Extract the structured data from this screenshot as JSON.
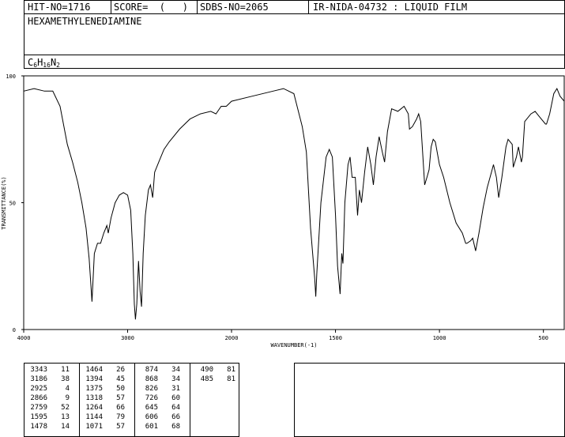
{
  "header": {
    "hit_no": "HIT-NO=1716",
    "score": "SCORE=  (   )",
    "sdbs_no": "SDBS-NO=2065",
    "ir_code": "IR-NIDA-04732 : LIQUID FILM",
    "compound_name": "HEXAMETHYLENEDIAMINE",
    "formula": {
      "C": "C",
      "c_count": "6",
      "H": "H",
      "h_count": "16",
      "N": "N",
      "n_count": "2"
    }
  },
  "chart_data": {
    "type": "line",
    "xlabel": "WAVENUMBER(-1)",
    "ylabel": "TRANSMITTANCE(%)",
    "xlim": [
      4000,
      400
    ],
    "ylim": [
      0,
      100
    ],
    "x_ticks": [
      "4000",
      "3000",
      "2000",
      "1500",
      "1000",
      "500"
    ],
    "x_tick_values": [
      4000,
      3000,
      2000,
      1500,
      1000,
      500
    ],
    "y_ticks": [
      "0",
      "50",
      "100"
    ],
    "y_tick_values": [
      0,
      50,
      100
    ],
    "series": [
      {
        "points": [
          [
            4000,
            94
          ],
          [
            3900,
            95
          ],
          [
            3800,
            94
          ],
          [
            3720,
            94
          ],
          [
            3650,
            88
          ],
          [
            3580,
            73
          ],
          [
            3530,
            66
          ],
          [
            3480,
            58
          ],
          [
            3440,
            50
          ],
          [
            3400,
            40
          ],
          [
            3370,
            28
          ],
          [
            3343,
            11
          ],
          [
            3320,
            30
          ],
          [
            3290,
            34
          ],
          [
            3260,
            34
          ],
          [
            3230,
            38
          ],
          [
            3200,
            41
          ],
          [
            3186,
            38
          ],
          [
            3160,
            44
          ],
          [
            3120,
            50
          ],
          [
            3080,
            53
          ],
          [
            3040,
            54
          ],
          [
            3000,
            53
          ],
          [
            2970,
            47
          ],
          [
            2950,
            30
          ],
          [
            2935,
            10
          ],
          [
            2925,
            4
          ],
          [
            2912,
            10
          ],
          [
            2895,
            27
          ],
          [
            2880,
            15
          ],
          [
            2866,
            9
          ],
          [
            2850,
            30
          ],
          [
            2830,
            45
          ],
          [
            2800,
            55
          ],
          [
            2780,
            57
          ],
          [
            2759,
            52
          ],
          [
            2740,
            62
          ],
          [
            2700,
            66
          ],
          [
            2650,
            71
          ],
          [
            2600,
            74
          ],
          [
            2500,
            79
          ],
          [
            2400,
            83
          ],
          [
            2300,
            85
          ],
          [
            2200,
            86
          ],
          [
            2150,
            85
          ],
          [
            2100,
            88
          ],
          [
            2050,
            88
          ],
          [
            2000,
            90
          ],
          [
            1900,
            92
          ],
          [
            1800,
            94
          ],
          [
            1750,
            95
          ],
          [
            1700,
            93
          ],
          [
            1660,
            80
          ],
          [
            1640,
            70
          ],
          [
            1620,
            40
          ],
          [
            1600,
            20
          ],
          [
            1595,
            13
          ],
          [
            1590,
            22
          ],
          [
            1570,
            50
          ],
          [
            1545,
            68
          ],
          [
            1530,
            71
          ],
          [
            1515,
            68
          ],
          [
            1500,
            45
          ],
          [
            1490,
            25
          ],
          [
            1478,
            14
          ],
          [
            1470,
            30
          ],
          [
            1464,
            26
          ],
          [
            1455,
            50
          ],
          [
            1440,
            65
          ],
          [
            1430,
            68
          ],
          [
            1420,
            60
          ],
          [
            1405,
            60
          ],
          [
            1394,
            45
          ],
          [
            1385,
            55
          ],
          [
            1375,
            50
          ],
          [
            1360,
            62
          ],
          [
            1345,
            72
          ],
          [
            1330,
            65
          ],
          [
            1318,
            57
          ],
          [
            1305,
            68
          ],
          [
            1290,
            76
          ],
          [
            1275,
            70
          ],
          [
            1264,
            66
          ],
          [
            1250,
            78
          ],
          [
            1230,
            87
          ],
          [
            1200,
            86
          ],
          [
            1170,
            88
          ],
          [
            1150,
            85
          ],
          [
            1144,
            79
          ],
          [
            1130,
            80
          ],
          [
            1110,
            83
          ],
          [
            1100,
            85
          ],
          [
            1090,
            82
          ],
          [
            1071,
            57
          ],
          [
            1060,
            60
          ],
          [
            1050,
            63
          ],
          [
            1040,
            72
          ],
          [
            1030,
            75
          ],
          [
            1020,
            74
          ],
          [
            1000,
            65
          ],
          [
            980,
            60
          ],
          [
            950,
            50
          ],
          [
            920,
            42
          ],
          [
            890,
            38
          ],
          [
            874,
            34
          ],
          [
            868,
            34
          ],
          [
            850,
            35
          ],
          [
            840,
            36
          ],
          [
            826,
            31
          ],
          [
            810,
            38
          ],
          [
            790,
            48
          ],
          [
            770,
            56
          ],
          [
            750,
            62
          ],
          [
            740,
            65
          ],
          [
            726,
            60
          ],
          [
            715,
            52
          ],
          [
            700,
            60
          ],
          [
            680,
            72
          ],
          [
            670,
            75
          ],
          [
            650,
            73
          ],
          [
            645,
            64
          ],
          [
            630,
            68
          ],
          [
            620,
            72
          ],
          [
            606,
            66
          ],
          [
            601,
            68
          ],
          [
            590,
            82
          ],
          [
            560,
            85
          ],
          [
            540,
            86
          ],
          [
            520,
            84
          ],
          [
            490,
            81
          ],
          [
            485,
            81
          ],
          [
            470,
            85
          ],
          [
            450,
            93
          ],
          [
            435,
            95
          ],
          [
            420,
            92
          ],
          [
            400,
            90
          ]
        ]
      }
    ]
  },
  "peak_table": {
    "col1": [
      [
        "3343",
        "11"
      ],
      [
        "3186",
        "38"
      ],
      [
        "2925",
        "4"
      ],
      [
        "2866",
        "9"
      ],
      [
        "2759",
        "52"
      ],
      [
        "1595",
        "13"
      ],
      [
        "1478",
        "14"
      ]
    ],
    "col2": [
      [
        "1464",
        "26"
      ],
      [
        "1394",
        "45"
      ],
      [
        "1375",
        "50"
      ],
      [
        "1318",
        "57"
      ],
      [
        "1264",
        "66"
      ],
      [
        "1144",
        "79"
      ],
      [
        "1071",
        "57"
      ]
    ],
    "col3": [
      [
        "874",
        "34"
      ],
      [
        "868",
        "34"
      ],
      [
        "826",
        "31"
      ],
      [
        "726",
        "60"
      ],
      [
        "645",
        "64"
      ],
      [
        "606",
        "66"
      ],
      [
        "601",
        "68"
      ]
    ],
    "col4": [
      [
        "490",
        "81"
      ],
      [
        "485",
        "81"
      ]
    ]
  }
}
